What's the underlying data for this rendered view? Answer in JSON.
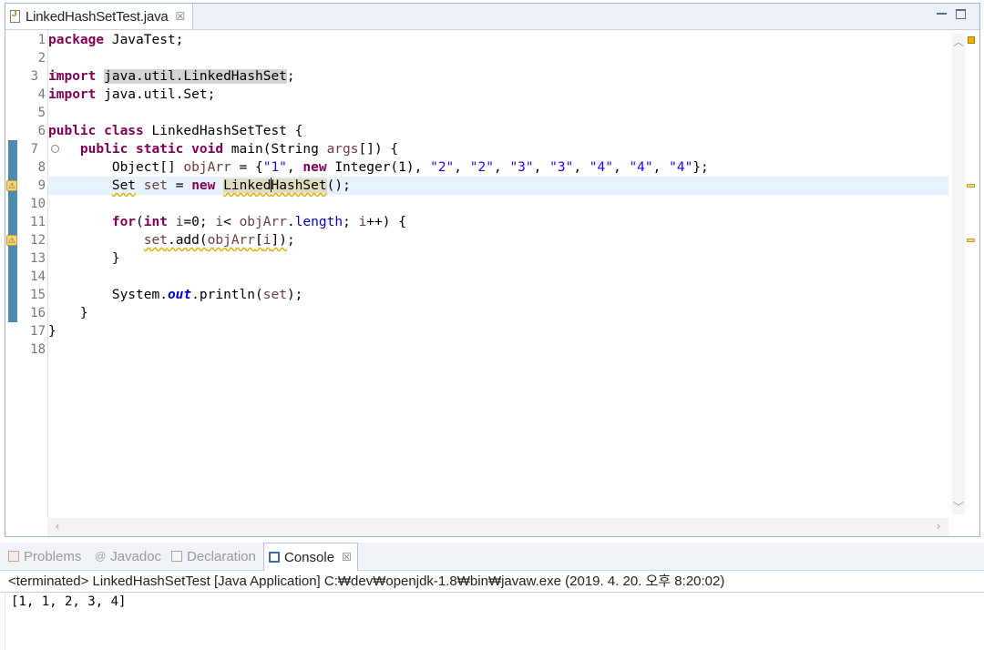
{
  "editor": {
    "tab_title": "LinkedHashSetTest.java",
    "tab_close_glyph": "☒",
    "line_numbers": [
      "1",
      "2",
      "3",
      "4",
      "5",
      "6",
      "7",
      "8",
      "9",
      "10",
      "11",
      "12",
      "13",
      "14",
      "15",
      "16",
      "17",
      "18"
    ],
    "fold_glyph": "⊖",
    "warning_glyph": "⚠",
    "current_line": 9
  },
  "code": {
    "l1_kw": "package",
    "l1_rest": " JavaTest;",
    "l3_kw": "import",
    "l3_sp": " ",
    "l3_hl": "java.util.LinkedHashSet",
    "l3_end": ";",
    "l4_kw": "import",
    "l4_rest": " java.util.Set;",
    "l6_kw": "public class",
    "l6_rest": " LinkedHashSetTest {",
    "l7_indent": "    ",
    "l7_kw": "public static void",
    "l7_a": " main(String ",
    "l7_var": "args",
    "l7_b": "[]) {",
    "l8_a": "        Object[] ",
    "l8_var": "objArr",
    "l8_b": " = {",
    "l8_s1": "\"1\"",
    "l8_c1": ", ",
    "l8_kw": "new",
    "l8_c2": " Integer(1), ",
    "l8_s2": "\"2\"",
    "l8_c3": ", ",
    "l8_s3": "\"2\"",
    "l8_c4": ", ",
    "l8_s4": "\"3\"",
    "l8_c5": ", ",
    "l8_s5": "\"3\"",
    "l8_c6": ", ",
    "l8_s6": "\"4\"",
    "l8_c7": ", ",
    "l8_s7": "\"4\"",
    "l8_c8": ", ",
    "l8_s8": "\"4\"",
    "l8_end": "};",
    "l9_indent": "        ",
    "l9_type": "Set",
    "l9_sp": " ",
    "l9_var": "set",
    "l9_eq": " = ",
    "l9_kw": "new",
    "l9_sp2": " ",
    "l9_cls_a": "Linked",
    "l9_cls_b": "HashSet",
    "l9_end": "();",
    "l11_indent": "        ",
    "l11_kw1": "for",
    "l11_a": "(",
    "l11_kw2": "int",
    "l11_sp": " ",
    "l11_v1": "i",
    "l11_b": "=0; ",
    "l11_v2": "i",
    "l11_c": "< ",
    "l11_v3": "objArr",
    "l11_d": ".",
    "l11_fld": "length",
    "l11_e": "; ",
    "l11_v4": "i",
    "l11_f": "++) {",
    "l12_indent": "            ",
    "l12_warn_a": "set",
    "l12_warn_b": ".add(",
    "l12_var": "objArr",
    "l12_warn_c": "[",
    "l12_var2": "i",
    "l12_warn_d": "])",
    "l12_end": ";",
    "l13": "        }",
    "l15_a": "        System.",
    "l15_sfld": "out",
    "l15_b": ".println(",
    "l15_var": "set",
    "l15_c": ");",
    "l16": "    }",
    "l17": "}"
  },
  "panel": {
    "tabs": [
      {
        "label": "Problems",
        "active": false
      },
      {
        "label": "Javadoc",
        "active": false
      },
      {
        "label": "Declaration",
        "active": false
      },
      {
        "label": "Console",
        "active": true
      }
    ],
    "javadoc_glyph": "@",
    "close_glyph": "☒"
  },
  "console": {
    "status": "<terminated> LinkedHashSetTest [Java Application] C:₩dev₩openjdk-1.8₩bin₩javaw.exe (2019. 4. 20. 오후 8:20:02)",
    "output": "[1, 1, 2, 3, 4]"
  },
  "colors": {
    "keyword": "#7f0055",
    "string": "#2a00ff",
    "local_variable": "#6a3e3e",
    "field": "#0000c0",
    "change_bar": "#4c8ab3",
    "current_line": "#e8f2fe"
  }
}
